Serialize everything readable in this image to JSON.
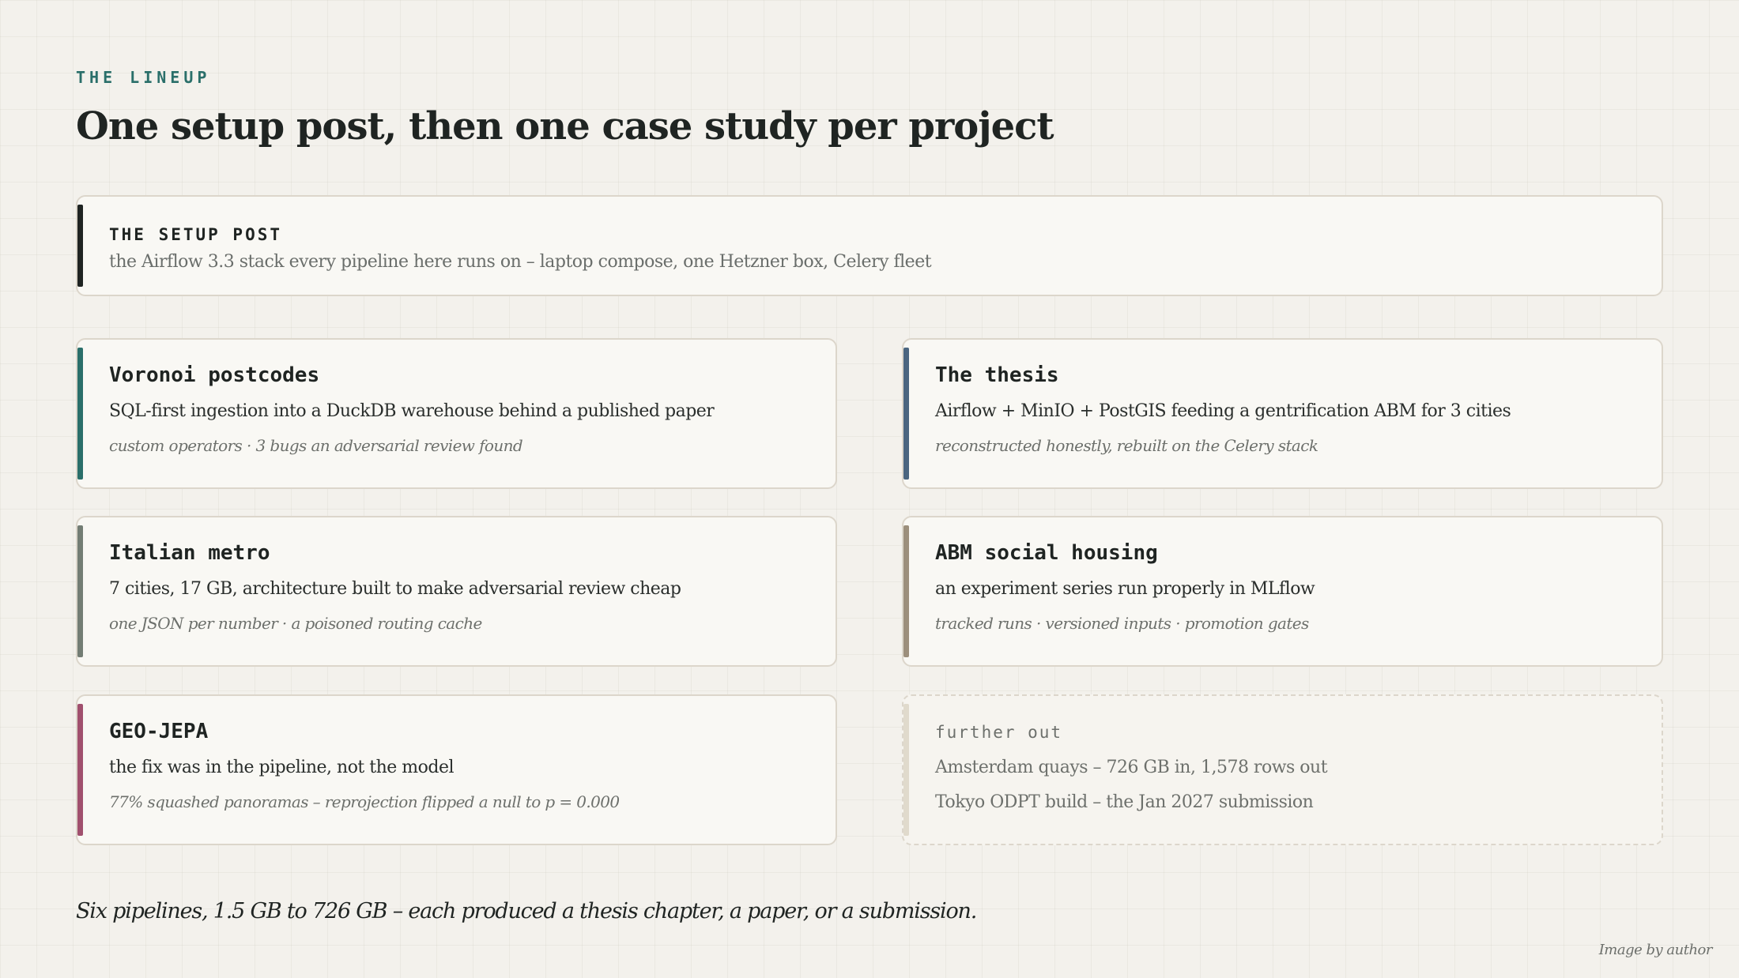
{
  "header": {
    "eyebrow": "THE LINEUP",
    "title": "One setup post, then one case study per project"
  },
  "setup": {
    "title": "THE SETUP POST",
    "description": "the Airflow 3.3 stack every pipeline here runs on – laptop compose, one Hetzner box, Celery fleet",
    "accent": "#1f2422"
  },
  "projects": [
    {
      "title": "Voronoi postcodes",
      "description": "SQL-first ingestion into a DuckDB warehouse behind a published paper",
      "note": "custom operators · 3 bugs an adversarial review found",
      "accent": "#2a6f6a"
    },
    {
      "title": "The thesis",
      "description": "Airflow + MinIO + PostGIS feeding a gentrification ABM for 3 cities",
      "note": "reconstructed honestly, rebuilt on the Celery stack",
      "accent": "#4a6580"
    },
    {
      "title": "Italian metro",
      "description": "7 cities, 17 GB, architecture built to make adversarial review cheap",
      "note": "one JSON per number · a poisoned routing cache",
      "accent": "#737d74"
    },
    {
      "title": "ABM social housing",
      "description": "an experiment series run properly in MLflow",
      "note": "tracked runs · versioned inputs · promotion gates",
      "accent": "#9c8f7c"
    },
    {
      "title": "GEO-JEPA",
      "description": "the fix was in the pipeline, not the model",
      "note": "77% squashed panoramas – reprojection flipped a null to p = 0.000",
      "accent": "#a0506e"
    }
  ],
  "further": {
    "title": "further out",
    "items": [
      "Amsterdam quays – 726 GB in, 1,578 rows out",
      "Tokyo ODPT build – the Jan 2027 submission"
    ],
    "accent": "#e0dacc"
  },
  "footer": {
    "summary": "Six pipelines, 1.5 GB to 726 GB – each produced a thesis chapter, a paper, or a submission.",
    "credit": "Image by author"
  }
}
